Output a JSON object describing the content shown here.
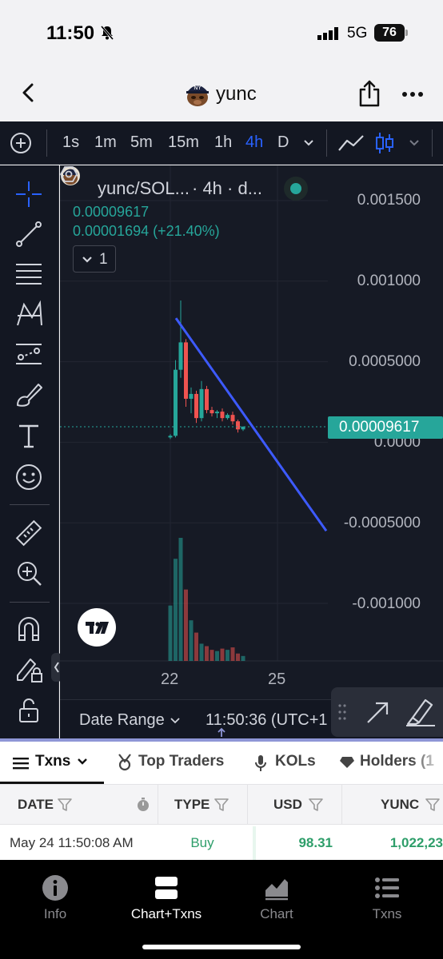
{
  "status_bar": {
    "time": "11:50",
    "network": "5G",
    "battery": "76"
  },
  "header": {
    "title": "yunc"
  },
  "toolbar": {
    "timeframes": [
      "1s",
      "1m",
      "5m",
      "15m",
      "1h",
      "4h",
      "D"
    ],
    "active_timeframe": "4h"
  },
  "legend": {
    "symbol": "yunc/SOL...",
    "meta": "· 4h · d...",
    "price": "0.00009617",
    "change": "0.00001694 (+21.40%)",
    "indicator_count": "1"
  },
  "price_axis": [
    "0.001500",
    "0.001000",
    "0.0005000",
    "0.0000",
    "-0.0005000",
    "-0.001000"
  ],
  "last_price": "0.00009617",
  "date_axis": [
    "22",
    "25"
  ],
  "chart_bar": {
    "date_range": "Date Range",
    "clock": "11:50:36 (UTC+1"
  },
  "tabs": [
    "Txns",
    "Top Traders",
    "KOLs",
    "Holders (1"
  ],
  "table": {
    "columns": [
      "DATE",
      "TYPE",
      "USD",
      "YUNC"
    ],
    "rows": [
      {
        "date": "May 24 11:50:08 AM",
        "type": "Buy",
        "usd": "98.31",
        "yunc": "1,022,23"
      }
    ]
  },
  "bottom_nav": [
    "Info",
    "Chart+Txns",
    "Chart",
    "Txns"
  ],
  "colors": {
    "up": "#26a69a",
    "down": "#ef5350",
    "accent": "#2962ff",
    "trendline": "#3d5afe",
    "buy": "#2e9e6a"
  },
  "chart_data": {
    "type": "candlestick",
    "title": "yunc/SOL...",
    "x_ticks": [
      "22",
      "25"
    ],
    "y_ticks": [
      "0.001500",
      "0.001000",
      "0.0005000",
      "0.0000",
      "-0.0005000",
      "-0.001000"
    ],
    "ylim": [
      -0.0011,
      0.0015
    ],
    "last_price": 9.617e-05,
    "candles": [
      {
        "o": 3e-05,
        "h": 5e-05,
        "l": 2e-05,
        "c": 4e-05
      },
      {
        "o": 4e-05,
        "h": 0.00051,
        "l": 3e-05,
        "c": 0.00045
      },
      {
        "o": 0.00045,
        "h": 0.00088,
        "l": 0.0004,
        "c": 0.00062
      },
      {
        "o": 0.00062,
        "h": 0.00064,
        "l": 0.00022,
        "c": 0.00027
      },
      {
        "o": 0.00027,
        "h": 0.00034,
        "l": 0.00018,
        "c": 0.0003
      },
      {
        "o": 0.0003,
        "h": 0.00032,
        "l": 0.00012,
        "c": 0.00015
      },
      {
        "o": 0.00015,
        "h": 0.00038,
        "l": 0.00013,
        "c": 0.00033
      },
      {
        "o": 0.00033,
        "h": 0.00035,
        "l": 0.00018,
        "c": 0.0002
      },
      {
        "o": 0.0002,
        "h": 0.00022,
        "l": 0.00016,
        "c": 0.00018
      },
      {
        "o": 0.00018,
        "h": 0.0002,
        "l": 0.00015,
        "c": 0.00019
      },
      {
        "o": 0.00019,
        "h": 0.00021,
        "l": 0.00013,
        "c": 0.00015
      },
      {
        "o": 0.00015,
        "h": 0.00018,
        "l": 0.00014,
        "c": 0.00017
      },
      {
        "o": 0.00017,
        "h": 0.00019,
        "l": 0.00011,
        "c": 0.00013
      },
      {
        "o": 0.00013,
        "h": 0.00014,
        "l": 6e-05,
        "c": 8e-05
      },
      {
        "o": 8e-05,
        "h": 0.0001,
        "l": 7e-05,
        "c": 9.617e-05
      }
    ],
    "volumes": [
      0.45,
      0.83,
      1.0,
      0.58,
      0.33,
      0.23,
      0.14,
      0.12,
      0.09,
      0.08,
      0.1,
      0.09,
      0.11,
      0.06,
      0.04
    ],
    "trendline": [
      [
        0,
        0.00077
      ],
      [
        1,
        -0.00055
      ]
    ]
  }
}
